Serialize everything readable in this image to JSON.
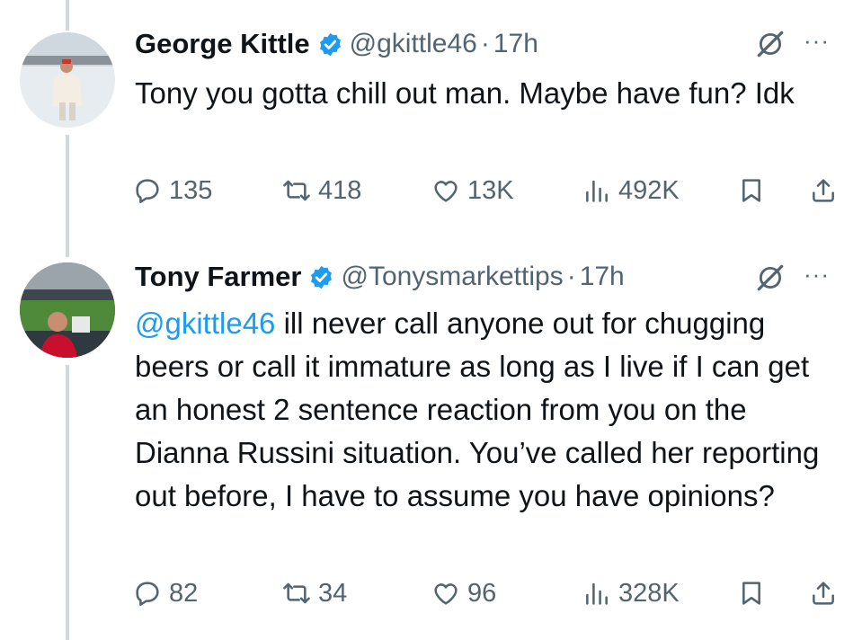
{
  "tweets": [
    {
      "author": {
        "name": "George Kittle",
        "handle": "@gkittle46",
        "verified": true
      },
      "time": "17h",
      "separator": "·",
      "text": "Tony you gotta chill out man. Maybe have fun? Idk",
      "stats": {
        "replies": "135",
        "reposts": "418",
        "likes": "13K",
        "views": "492K"
      }
    },
    {
      "author": {
        "name": "Tony Farmer",
        "handle": "@Tonysmarkettips",
        "verified": true
      },
      "time": "17h",
      "separator": "·",
      "mention": "@gkittle46",
      "text": " ill never call anyone out for chugging beers or call it immature as long as I live if I can get an honest 2 sentence reaction from you on the Dianna Russini situation. You’ve called her reporting out before, I have to assume you have opinions?",
      "stats": {
        "replies": "82",
        "reposts": "34",
        "likes": "96",
        "views": "328K"
      }
    }
  ],
  "more_label": "···",
  "colors": {
    "accent": "#1d9bf0",
    "text": "#0f1419",
    "muted": "#536471",
    "thread_line": "#cfd9de"
  }
}
